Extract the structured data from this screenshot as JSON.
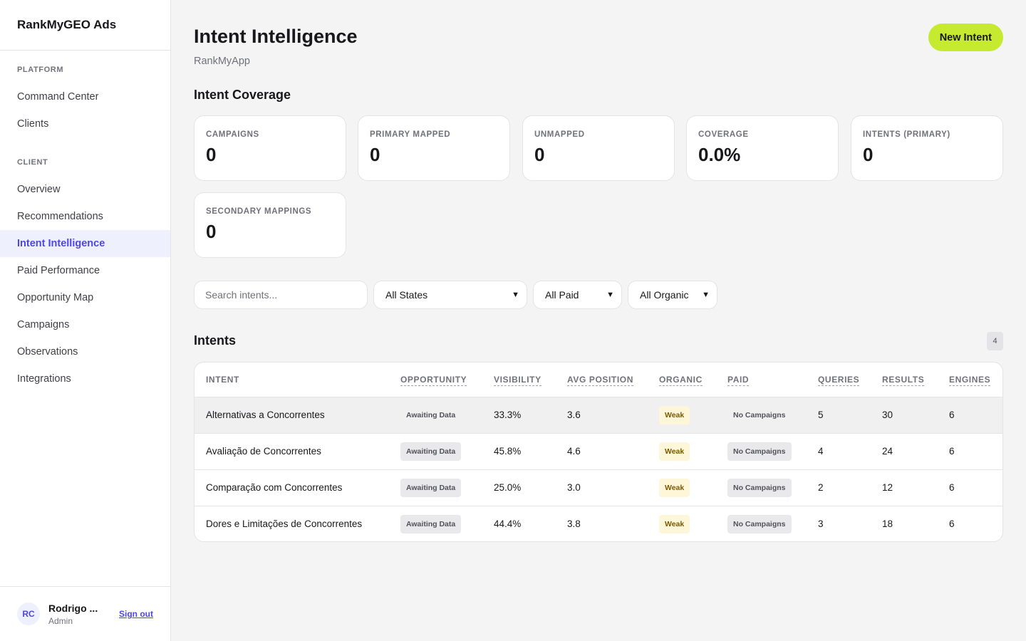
{
  "app": {
    "title": "RankMyGEO Ads"
  },
  "sidebar": {
    "platform_label": "PLATFORM",
    "platform_items": [
      {
        "label": "Command Center"
      },
      {
        "label": "Clients"
      }
    ],
    "client_label": "CLIENT",
    "client_items": [
      {
        "label": "Overview"
      },
      {
        "label": "Recommendations"
      },
      {
        "label": "Intent Intelligence",
        "active": true
      },
      {
        "label": "Paid Performance"
      },
      {
        "label": "Opportunity Map"
      },
      {
        "label": "Campaigns"
      },
      {
        "label": "Observations"
      },
      {
        "label": "Integrations"
      }
    ],
    "user": {
      "initials": "RC",
      "name": "Rodrigo ...",
      "role": "Admin",
      "signout": "Sign out"
    }
  },
  "header": {
    "title": "Intent Intelligence",
    "subtitle": "RankMyApp",
    "new_button": "New Intent"
  },
  "coverage": {
    "title": "Intent Coverage",
    "cards": [
      {
        "label": "CAMPAIGNS",
        "value": "0"
      },
      {
        "label": "PRIMARY MAPPED",
        "value": "0"
      },
      {
        "label": "UNMAPPED",
        "value": "0"
      },
      {
        "label": "COVERAGE",
        "value": "0.0%"
      },
      {
        "label": "INTENTS (PRIMARY)",
        "value": "0"
      },
      {
        "label": "SECONDARY MAPPINGS",
        "value": "0"
      }
    ]
  },
  "filters": {
    "search_placeholder": "Search intents...",
    "states": "All States",
    "paid": "All Paid",
    "organic": "All Organic"
  },
  "intents": {
    "title": "Intents",
    "count": "4",
    "columns": [
      "INTENT",
      "OPPORTUNITY",
      "VISIBILITY",
      "AVG POSITION",
      "ORGANIC",
      "PAID",
      "QUERIES",
      "RESULTS",
      "ENGINES"
    ],
    "rows": [
      {
        "intent": "Alternativas a Concorrentes",
        "opportunity": "Awaiting Data",
        "visibility": "33.3%",
        "avg_position": "3.6",
        "organic": "Weak",
        "paid": "No Campaigns",
        "queries": "5",
        "results": "30",
        "engines": "6"
      },
      {
        "intent": "Avaliação de Concorrentes",
        "opportunity": "Awaiting Data",
        "visibility": "45.8%",
        "avg_position": "4.6",
        "organic": "Weak",
        "paid": "No Campaigns",
        "queries": "4",
        "results": "24",
        "engines": "6"
      },
      {
        "intent": "Comparação com Concorrentes",
        "opportunity": "Awaiting Data",
        "visibility": "25.0%",
        "avg_position": "3.0",
        "organic": "Weak",
        "paid": "No Campaigns",
        "queries": "2",
        "results": "12",
        "engines": "6"
      },
      {
        "intent": "Dores e Limitações de Concorrentes",
        "opportunity": "Awaiting Data",
        "visibility": "44.4%",
        "avg_position": "3.8",
        "organic": "Weak",
        "paid": "No Campaigns",
        "queries": "3",
        "results": "18",
        "engines": "6"
      }
    ]
  },
  "colors": {
    "accent": "#4f46e5",
    "primary_button": "#c5ea2f",
    "weak_badge": "#fdf6d8"
  }
}
